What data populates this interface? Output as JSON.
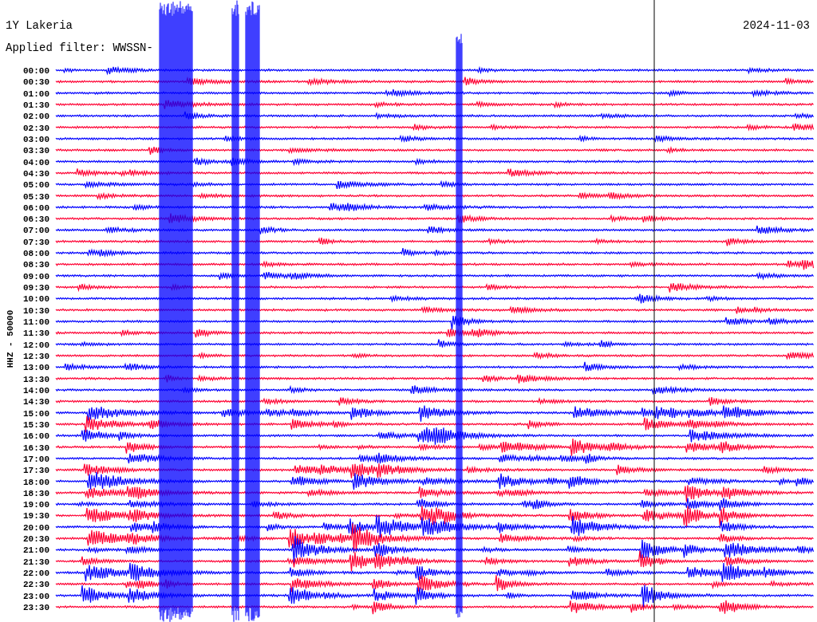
{
  "header": {
    "station": "1Y Lakeria",
    "filter": "Applied filter: WWSSN-",
    "date": "2024-11-03"
  },
  "axis_label": "HHZ - 50000",
  "rows": [
    {
      "time": "00:00",
      "color": "#0000ff"
    },
    {
      "time": "00:30",
      "color": "#ff0033"
    },
    {
      "time": "01:00",
      "color": "#0000ff"
    },
    {
      "time": "01:30",
      "color": "#ff0033"
    },
    {
      "time": "02:00",
      "color": "#0000ff"
    },
    {
      "time": "02:30",
      "color": "#ff0033"
    },
    {
      "time": "03:00",
      "color": "#0000ff"
    },
    {
      "time": "03:30",
      "color": "#ff0033"
    },
    {
      "time": "04:00",
      "color": "#0000ff"
    },
    {
      "time": "04:30",
      "color": "#ff0033"
    },
    {
      "time": "05:00",
      "color": "#0000ff"
    },
    {
      "time": "05:30",
      "color": "#ff0033"
    },
    {
      "time": "06:00",
      "color": "#0000ff"
    },
    {
      "time": "06:30",
      "color": "#ff0033"
    },
    {
      "time": "07:00",
      "color": "#0000ff"
    },
    {
      "time": "07:30",
      "color": "#ff0033"
    },
    {
      "time": "08:00",
      "color": "#0000ff"
    },
    {
      "time": "08:30",
      "color": "#ff0033"
    },
    {
      "time": "09:00",
      "color": "#0000ff"
    },
    {
      "time": "09:30",
      "color": "#ff0033"
    },
    {
      "time": "10:00",
      "color": "#0000ff"
    },
    {
      "time": "10:30",
      "color": "#ff0033"
    },
    {
      "time": "11:00",
      "color": "#0000ff"
    },
    {
      "time": "11:30",
      "color": "#ff0033"
    },
    {
      "time": "12:00",
      "color": "#0000ff"
    },
    {
      "time": "12:30",
      "color": "#ff0033"
    },
    {
      "time": "13:00",
      "color": "#0000ff"
    },
    {
      "time": "13:30",
      "color": "#ff0033"
    },
    {
      "time": "14:00",
      "color": "#0000ff"
    },
    {
      "time": "14:30",
      "color": "#ff0033"
    },
    {
      "time": "15:00",
      "color": "#0000ff"
    },
    {
      "time": "15:30",
      "color": "#ff0033"
    },
    {
      "time": "16:00",
      "color": "#0000ff"
    },
    {
      "time": "16:30",
      "color": "#ff0033"
    },
    {
      "time": "17:00",
      "color": "#0000ff"
    },
    {
      "time": "17:30",
      "color": "#ff0033"
    },
    {
      "time": "18:00",
      "color": "#0000ff"
    },
    {
      "time": "18:30",
      "color": "#ff0033"
    },
    {
      "time": "19:00",
      "color": "#0000ff"
    },
    {
      "time": "19:30",
      "color": "#ff0033"
    },
    {
      "time": "20:00",
      "color": "#0000ff"
    },
    {
      "time": "20:30",
      "color": "#ff0033"
    },
    {
      "time": "21:00",
      "color": "#0000ff"
    },
    {
      "time": "21:30",
      "color": "#ff0033"
    },
    {
      "time": "22:00",
      "color": "#0000ff"
    },
    {
      "time": "22:30",
      "color": "#ff0033"
    },
    {
      "time": "23:00",
      "color": "#0000ff"
    },
    {
      "time": "23:30",
      "color": "#ff0033"
    }
  ]
}
